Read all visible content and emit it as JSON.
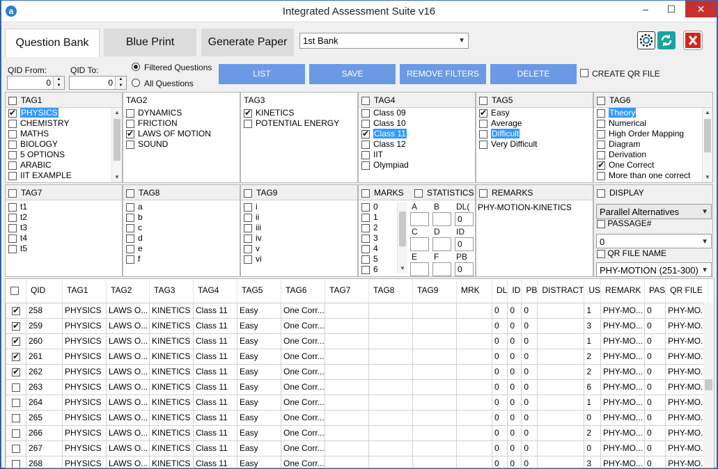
{
  "window": {
    "title": "Integrated Assessment Suite v16",
    "app_icon": "a",
    "minimize": "–",
    "maximize": "☐",
    "close": "✕"
  },
  "tabs": [
    {
      "label": "Question Bank",
      "active": true
    },
    {
      "label": "Blue Print",
      "active": false
    },
    {
      "label": "Generate Paper",
      "active": false
    }
  ],
  "bank_select": {
    "value": "1st Bank"
  },
  "qid": {
    "from_label": "QID From:",
    "from_value": "0",
    "to_label": "QID To:",
    "to_value": "0"
  },
  "filter_mode": {
    "filtered": "Filtered Questions",
    "all": "All Questions",
    "selected": "filtered"
  },
  "buttons": {
    "list": "LIST",
    "save": "SAVE",
    "remove_filters": "REMOVE FILTERS",
    "delete": "DELETE"
  },
  "create_qr": {
    "label": "CREATE QR FILE",
    "checked": false
  },
  "tag1": {
    "title": "TAG1",
    "items": [
      {
        "label": "PHYSICS",
        "checked": true,
        "selected": true
      },
      {
        "label": "CHEMISTRY",
        "checked": false
      },
      {
        "label": "MATHS",
        "checked": false
      },
      {
        "label": "BIOLOGY",
        "checked": false
      },
      {
        "label": "5 OPTIONS",
        "checked": false
      },
      {
        "label": "ARABIC",
        "checked": false
      },
      {
        "label": "IIT EXAMPLE",
        "checked": false
      }
    ]
  },
  "tag2": {
    "title": "TAG2",
    "items": [
      {
        "label": "DYNAMICS",
        "checked": false
      },
      {
        "label": "FRICTION",
        "checked": false
      },
      {
        "label": "LAWS OF MOTION",
        "checked": true
      },
      {
        "label": "SOUND",
        "checked": false
      }
    ]
  },
  "tag3": {
    "title": "TAG3",
    "items": [
      {
        "label": "KINETICS",
        "checked": true
      },
      {
        "label": "POTENTIAL ENERGY",
        "checked": false
      }
    ]
  },
  "tag4": {
    "title": "TAG4",
    "items": [
      {
        "label": "Class 09",
        "checked": false
      },
      {
        "label": "Class 10",
        "checked": false
      },
      {
        "label": "Class 11",
        "checked": true,
        "selected": true
      },
      {
        "label": "Class 12",
        "checked": false
      },
      {
        "label": "IIT",
        "checked": false
      },
      {
        "label": "Olympiad",
        "checked": false
      }
    ]
  },
  "tag5": {
    "title": "TAG5",
    "items": [
      {
        "label": "Easy",
        "checked": true
      },
      {
        "label": "Average",
        "checked": false
      },
      {
        "label": "Difficult",
        "checked": false,
        "selected": true
      },
      {
        "label": "Very Difficult",
        "checked": false
      }
    ]
  },
  "tag6": {
    "title": "TAG6",
    "items": [
      {
        "label": "Theory",
        "checked": false,
        "selected": true
      },
      {
        "label": "Numerical",
        "checked": false
      },
      {
        "label": "High Order Mapping",
        "checked": false
      },
      {
        "label": "Diagram",
        "checked": false
      },
      {
        "label": "Derivation",
        "checked": false
      },
      {
        "label": "One Correct",
        "checked": true
      },
      {
        "label": "More than one correct",
        "checked": false
      }
    ]
  },
  "tag7": {
    "title": "TAG7",
    "items": [
      "t1",
      "t2",
      "t3",
      "t4",
      "t5"
    ]
  },
  "tag8": {
    "title": "TAG8",
    "items": [
      "a",
      "b",
      "c",
      "d",
      "e",
      "f"
    ]
  },
  "tag9": {
    "title": "TAG9",
    "items": [
      "i",
      "ii",
      "iii",
      "iv",
      "v",
      "vi"
    ]
  },
  "marks": {
    "title": "MARKS",
    "items": [
      "0",
      "1",
      "2",
      "3",
      "4",
      "5",
      "6"
    ]
  },
  "statistics": {
    "title": "STATISTICS",
    "fields": [
      {
        "label": "A",
        "value": ""
      },
      {
        "label": "B",
        "value": ""
      },
      {
        "label": "DL(",
        "value": "0"
      },
      {
        "label": "C",
        "value": ""
      },
      {
        "label": "D",
        "value": ""
      },
      {
        "label": "ID",
        "value": "0"
      },
      {
        "label": "E",
        "value": ""
      },
      {
        "label": "F",
        "value": ""
      },
      {
        "label": "PB",
        "value": "0"
      }
    ]
  },
  "remarks": {
    "title": "REMARKS",
    "value": "PHY-MOTION-KINETICS"
  },
  "display": {
    "title": "DISPLAY",
    "select": "Parallel Alternatives",
    "passage_label": "PASSAGE#",
    "passage_value": "0",
    "qr_label": "QR FILE NAME",
    "qr_value": "PHY-MOTION (251-300)"
  },
  "grid": {
    "columns": [
      "",
      "QID",
      "TAG1",
      "TAG2",
      "TAG3",
      "TAG4",
      "TAG5",
      "TAG6",
      "TAG7",
      "TAG8",
      "TAG9",
      "MRK",
      "DL",
      "ID",
      "PB",
      "DISTRACT",
      "US",
      "REMARK",
      "PAS",
      "QR FILE"
    ],
    "rows": [
      {
        "checked": true,
        "cells": [
          "258",
          "PHYSICS",
          "LAWS O...",
          "KINETICS",
          "Class 11",
          "Easy",
          "One Corr...",
          "",
          "",
          "",
          "",
          "0",
          "0",
          "0",
          "",
          "1",
          "PHY-MO...",
          "0",
          "PHY-MO..."
        ]
      },
      {
        "checked": true,
        "cells": [
          "259",
          "PHYSICS",
          "LAWS O...",
          "KINETICS",
          "Class 11",
          "Easy",
          "One Corr...",
          "",
          "",
          "",
          "",
          "0",
          "0",
          "0",
          "",
          "3",
          "PHY-MO...",
          "0",
          "PHY-MO..."
        ]
      },
      {
        "checked": true,
        "cells": [
          "260",
          "PHYSICS",
          "LAWS O...",
          "KINETICS",
          "Class 11",
          "Easy",
          "One Corr...",
          "",
          "",
          "",
          "",
          "0",
          "0",
          "0",
          "",
          "1",
          "PHY-MO...",
          "0",
          "PHY-MO..."
        ]
      },
      {
        "checked": true,
        "cells": [
          "261",
          "PHYSICS",
          "LAWS O...",
          "KINETICS",
          "Class 11",
          "Easy",
          "One Corr...",
          "",
          "",
          "",
          "",
          "0",
          "0",
          "0",
          "",
          "2",
          "PHY-MO...",
          "0",
          "PHY-MO..."
        ]
      },
      {
        "checked": true,
        "cells": [
          "262",
          "PHYSICS",
          "LAWS O...",
          "KINETICS",
          "Class 11",
          "Easy",
          "One Corr...",
          "",
          "",
          "",
          "",
          "0",
          "0",
          "0",
          "",
          "2",
          "PHY-MO...",
          "0",
          "PHY-MO..."
        ]
      },
      {
        "checked": false,
        "cells": [
          "263",
          "PHYSICS",
          "LAWS O...",
          "KINETICS",
          "Class 11",
          "Easy",
          "One Corr...",
          "",
          "",
          "",
          "",
          "0",
          "0",
          "0",
          "",
          "6",
          "PHY-MO...",
          "0",
          "PHY-MO..."
        ]
      },
      {
        "checked": false,
        "cells": [
          "264",
          "PHYSICS",
          "LAWS O...",
          "KINETICS",
          "Class 11",
          "Easy",
          "One Corr...",
          "",
          "",
          "",
          "",
          "0",
          "0",
          "0",
          "",
          "1",
          "PHY-MO...",
          "0",
          "PHY-MO..."
        ]
      },
      {
        "checked": false,
        "cells": [
          "265",
          "PHYSICS",
          "LAWS O...",
          "KINETICS",
          "Class 11",
          "Easy",
          "One Corr...",
          "",
          "",
          "",
          "",
          "0",
          "0",
          "0",
          "",
          "0",
          "PHY-MO...",
          "0",
          "PHY-MO..."
        ]
      },
      {
        "checked": false,
        "cells": [
          "266",
          "PHYSICS",
          "LAWS O...",
          "KINETICS",
          "Class 11",
          "Easy",
          "One Corr...",
          "",
          "",
          "",
          "",
          "0",
          "0",
          "0",
          "",
          "2",
          "PHY-MO...",
          "0",
          "PHY-MO..."
        ]
      },
      {
        "checked": false,
        "cells": [
          "267",
          "PHYSICS",
          "LAWS O...",
          "KINETICS",
          "Class 11",
          "Easy",
          "One Corr...",
          "",
          "",
          "",
          "",
          "0",
          "0",
          "0",
          "",
          "0",
          "PHY-MO...",
          "0",
          "PHY-MO..."
        ]
      },
      {
        "checked": false,
        "cells": [
          "268",
          "PHYSICS",
          "LAWS O...",
          "KINETICS",
          "Class 11",
          "Easy",
          "One Corr...",
          "",
          "",
          "",
          "",
          "0",
          "0",
          "0",
          "",
          "3",
          "PHY-MO...",
          "0",
          "PHY-MO..."
        ]
      }
    ]
  },
  "icons": {
    "settings": "settings-gear-icon",
    "refresh": "refresh-icon",
    "exit": "exit-icon"
  },
  "colors": {
    "accent_button": "#6b9ae4",
    "selection": "#3399ff",
    "close": "#c7312b"
  }
}
